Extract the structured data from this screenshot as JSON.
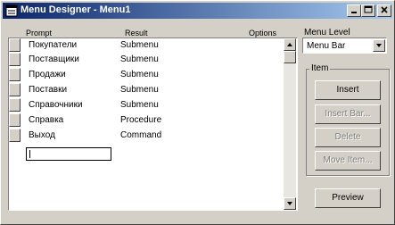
{
  "window": {
    "title": "Menu Designer - Menu1"
  },
  "columns": {
    "prompt": "Prompt",
    "result": "Result",
    "options": "Options"
  },
  "rows": [
    {
      "prompt": "Покупатели",
      "result": "Submenu"
    },
    {
      "prompt": "Поставщики",
      "result": "Submenu"
    },
    {
      "prompt": "Продажи",
      "result": "Submenu"
    },
    {
      "prompt": "Поставки",
      "result": "Submenu"
    },
    {
      "prompt": "Справочники",
      "result": "Submenu"
    },
    {
      "prompt": "Справка",
      "result": "Procedure"
    },
    {
      "prompt": "Выход",
      "result": "Command"
    }
  ],
  "new_row_value": "",
  "menu_level": {
    "label": "Menu Level",
    "value": "Menu Bar"
  },
  "item_group": {
    "title": "Item",
    "insert": "Insert",
    "insert_bar": "Insert Bar...",
    "delete": "Delete",
    "move_item": "Move Item..."
  },
  "preview": "Preview"
}
